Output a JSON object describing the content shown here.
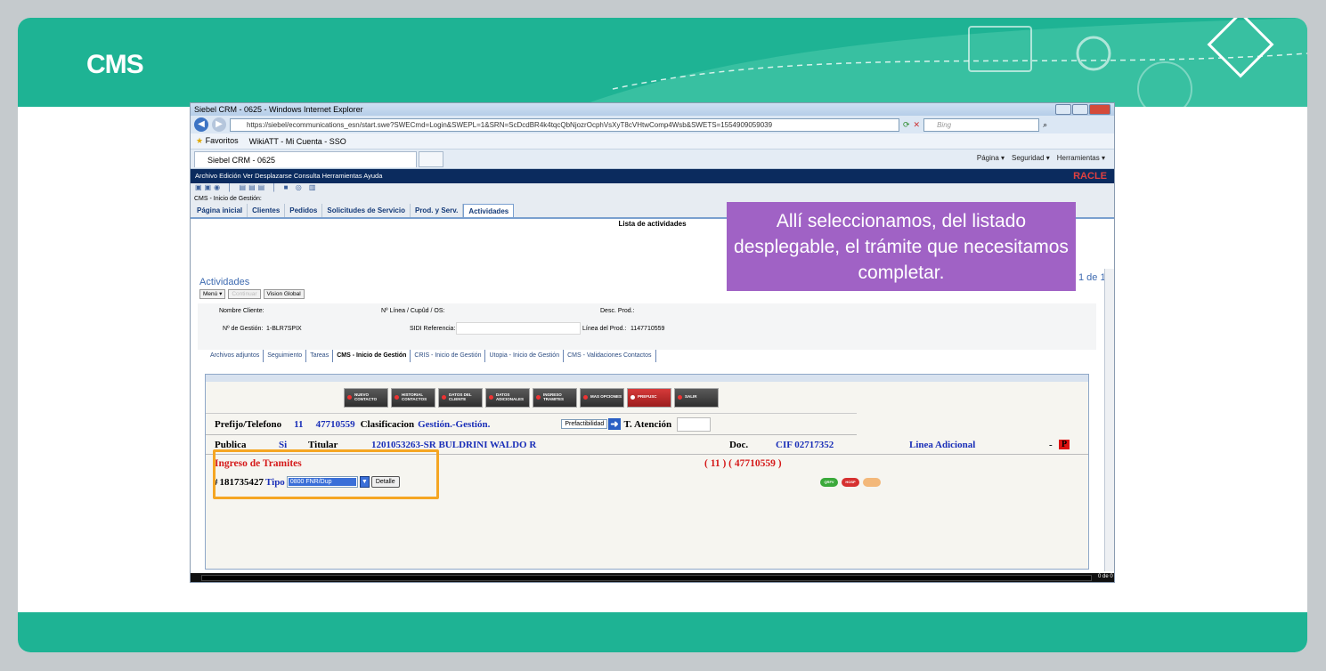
{
  "slide": {
    "title": "CMS",
    "callout": "Allí seleccionamos, del listado desplegable, el trámite que necesitamos completar."
  },
  "browser": {
    "window_title": "Siebel CRM - 0625 - Windows Internet Explorer",
    "url": "https://siebel/ecommunications_esn/start.swe?SWECmd=Login&SWEPL=1&SRN=ScDcdBR4k4tqcQbNjozrOcphVsXyT8cVHtwComp4Wsb&SWETS=1554909059039",
    "search_placeholder": "Bing",
    "favorites_label": "Favoritos",
    "favorite_link": "WikiATT - Mi Cuenta - SSO",
    "tab_label": "Siebel CRM - 0625",
    "command_bar": [
      "Página ▾",
      "Seguridad ▾",
      "Herramientas ▾"
    ]
  },
  "siebel": {
    "menu": "Archivo  Edición  Ver  Desplazarse  Consulta  Herramientas  Ayuda",
    "brand": "RACLE",
    "breadcrumb": "CMS - Inicio de Gestión:",
    "tabs": [
      "Página inicial",
      "Clientes",
      "Pedidos",
      "Solicitudes de Servicio",
      "Prod. y Serv.",
      "Actividades"
    ],
    "list_title": "Lista de actividades",
    "applet_title": "Actividades",
    "pager": "1 de 1",
    "menu_button": "Menú ▾",
    "disabled_button": "Continuar",
    "vision_button": "Vision Global",
    "form": {
      "nombre_cliente": "Nombre Cliente:",
      "linea_label": "Nº Línea / Cupûd / OS:",
      "desc_prod": "Desc. Prod.:",
      "gestion_label": "Nº de Gestión:",
      "gestion_value": "1-BLR7SPIX",
      "sidi_label": "SIDI Referencia:",
      "linea_prod_label": "Línea del Prod.:",
      "linea_prod_value": "1147710559"
    },
    "view_tabs": [
      "Archivos adjuntos",
      "Seguimiento",
      "Tareas",
      "CMS - Inicio de Gestión",
      "CRIS - Inicio de Gestión",
      "Utopia - Inicio de Gestión",
      "CMS - Validaciones Contactos"
    ],
    "crm_buttons": [
      "NUEVO CONTACTO",
      "HISTORIAL CONTACTOS",
      "DATOS DEL CLIENTE",
      "DATOS ADICIONALES",
      "INGRESO TRAMITES",
      "MAS OPCIONES",
      "PREFUSC",
      "SALIR"
    ],
    "row1": {
      "prefijo_label": "Prefijo/Telefono",
      "prefijo": "11",
      "telefono": "47710559",
      "clasif_label": "Clasificacion",
      "clasif_value": "Gestión.-Gestión.",
      "factibilidad": "Prefactibilidad",
      "atencion_label": "T. Atención"
    },
    "row2": {
      "publica_label": "Publica",
      "publica_value": "Si",
      "titular_label": "Titular",
      "titular_value": "1201053263-SR BULDRINI WALDO R",
      "doc_label": "Doc.",
      "doc_value": "CIF 02717352",
      "linea_adicional": "Linea Adicional",
      "dash": "-",
      "flag": "P"
    },
    "ingreso_title": "Ingreso de Tramites",
    "cuenta": "( 11 ) ( 47710559 )",
    "tramite": {
      "hash": "#",
      "numero": "181735427",
      "tipo_label": "Tipo",
      "tipo_value": "0800 FNR/Dup",
      "detalle_button": "Detalle"
    },
    "pills": [
      "QRFV",
      "HOSP",
      ""
    ],
    "footer_pager": "0 de 0"
  },
  "colors": {
    "brand_green": "#1eb394",
    "callout_purple": "#a062c5",
    "highlight_orange": "#f5a623"
  }
}
